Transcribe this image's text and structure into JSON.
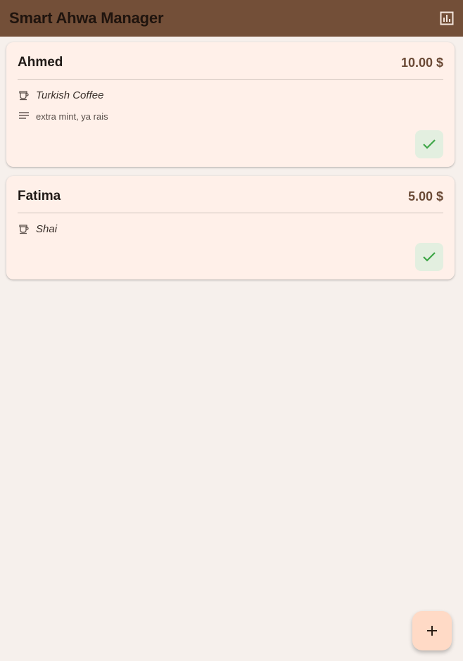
{
  "app": {
    "title": "Smart Ahwa Manager",
    "actions": {
      "reports_icon": "bar-chart-icon"
    }
  },
  "orders": [
    {
      "customer": "Ahmed",
      "price": "10.00 $",
      "drink": "Turkish Coffee",
      "drink_icon": "coffee-cup-icon",
      "note": "extra mint, ya rais",
      "note_icon": "notes-icon",
      "action_icon": "check-icon"
    },
    {
      "customer": "Fatima",
      "price": "5.00 $",
      "drink": "Shai",
      "drink_icon": "coffee-cup-icon",
      "action_icon": "check-icon"
    }
  ],
  "fab": {
    "icon": "plus-icon"
  },
  "colors": {
    "appbar": "#734f38",
    "background": "#f6f0ec",
    "card": "#fff0e9",
    "price": "#6b4a36",
    "done_button": "#e3efe0",
    "check": "#3fa648",
    "fab": "#ffdac6"
  }
}
